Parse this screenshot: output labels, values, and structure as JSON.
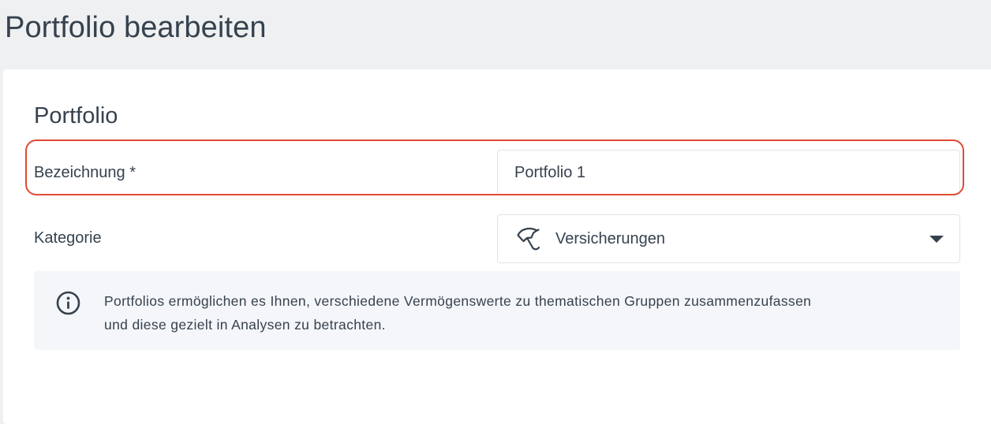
{
  "page": {
    "title": "Portfolio bearbeiten"
  },
  "form": {
    "section_title": "Portfolio",
    "name_label": "Bezeichnung *",
    "name_value": "Portfolio 1",
    "category_label": "Kategorie",
    "category_value": "Versicherungen",
    "category_icon": "umbrella-icon",
    "select_caret_icon": "caret-down-icon"
  },
  "info": {
    "icon": "info-icon",
    "text_line1": "Portfolios ermöglichen es Ihnen, verschiedene Vermögenswerte zu thematischen Gruppen zusammenzufassen",
    "text_line2": "und diese gezielt in Analysen zu betrachten."
  },
  "colors": {
    "page_background": "#eef0f2",
    "card_background": "#ffffff",
    "text": "#36424e",
    "input_border": "#dfe3e7",
    "highlight_border": "#e04a33",
    "info_background": "#f4f6f9"
  }
}
